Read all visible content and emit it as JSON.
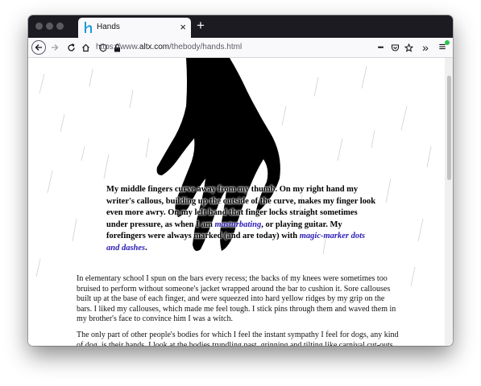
{
  "browser": {
    "tab_title": "Hands",
    "tab_close": "×",
    "new_tab": "+",
    "url_prefix": "https://www.",
    "url_domain": "altx.com",
    "url_path": "/thebody/hands.html",
    "menu_glyph": "•••",
    "overflow_glyph": "»",
    "hamburger_glyph": "≡"
  },
  "page": {
    "caption_1": "My middle fingers curve away from my thumb. On my right hand my writer's callous, building up the outside of the curve, makes my finger look even more awry. On my left hand that finger locks straight sometimes under pressure, as when I am ",
    "caption_link_1": "masturbating",
    "caption_2": ", or playing guitar. My forefingers were always marked (and are today) with ",
    "caption_link_2": "magic-marker dots and dashes",
    "caption_3": ".",
    "para_1": "In elementary school I spun on the bars every recess; the backs of my knees were sometimes too bruised to perform without someone's jacket wrapped around the bar to cushion it. Sore callouses built up at the base of each finger, and were squeezed into hard yellow ridges by my grip on the bars. I liked my callouses, which made me feel tough. I stick pins through them and waved them in my brother's face to convince him I was a witch.",
    "para_2": "The only part of other people's bodies for which I feel the instant sympathy I feel for dogs, any kind of dog, is their hands. I look at the bodies trundling past, grinning and tilting like carnival cut-outs you're meant to hit with bean bags, and I can't see past the paint. Watching a herd of goats would be"
  },
  "colors": {
    "tabbar": "#1c1b22",
    "link": "#2a1bb5",
    "accent_badge": "#2ac34a"
  }
}
